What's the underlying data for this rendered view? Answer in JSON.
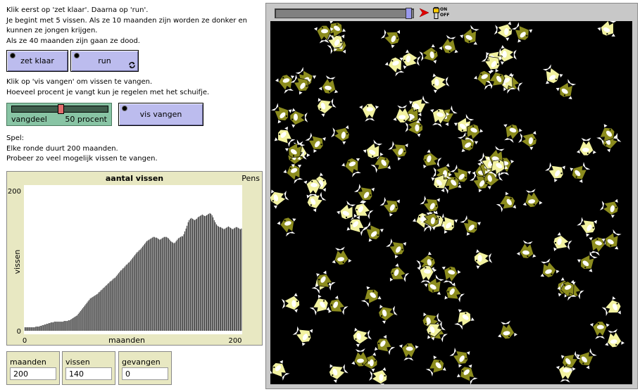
{
  "info": {
    "line1": "Klik eerst op 'zet klaar'. Daarna op 'run'.",
    "line2": "Je begint met 5 vissen. Als ze 10 maanden zijn worden ze donker en",
    "line3": "kunnen ze jongen krijgen.",
    "line4": "Als ze 40 maanden zijn gaan ze dood."
  },
  "buttons": {
    "setup": "zet klaar",
    "run": "run",
    "catch": "vis vangen"
  },
  "catch_info": {
    "line1": "Klik op 'vis vangen' om vissen te vangen.",
    "line2": "Hoeveel procent je vangt kun je regelen met het schuifje."
  },
  "slider": {
    "label": "vangdeel",
    "value_text": "50 procent",
    "value": 50,
    "min": 0,
    "max": 100
  },
  "game_info": {
    "line1": "Spel:",
    "line2": "Elke ronde duurt 200 maanden.",
    "line3": "Probeer zo veel mogelijk vissen te vangen."
  },
  "plot": {
    "title": "aantal vissen",
    "pens_label": "Pens"
  },
  "chart_data": {
    "type": "bar",
    "title": "aantal vissen",
    "xlabel": "maanden",
    "ylabel": "vissen",
    "xlim": [
      0,
      200
    ],
    "ylim": [
      0,
      200
    ],
    "x_ticks": [
      "0",
      "200"
    ],
    "y_ticks": [
      "0",
      "200"
    ],
    "values": [
      5,
      5,
      5,
      5,
      5,
      5,
      5,
      5,
      5,
      5,
      6,
      6,
      6,
      6,
      7,
      7,
      8,
      8,
      9,
      9,
      10,
      10,
      11,
      11,
      12,
      12,
      12,
      13,
      13,
      13,
      13,
      13,
      13,
      13,
      13,
      13,
      14,
      14,
      14,
      14,
      15,
      15,
      16,
      17,
      18,
      19,
      20,
      21,
      22,
      24,
      26,
      28,
      30,
      32,
      34,
      36,
      38,
      40,
      42,
      44,
      46,
      47,
      48,
      49,
      50,
      51,
      52,
      53,
      55,
      56,
      58,
      59,
      61,
      62,
      64,
      65,
      67,
      68,
      70,
      71,
      72,
      74,
      75,
      76,
      78,
      80,
      82,
      84,
      86,
      87,
      89,
      90,
      92,
      94,
      95,
      97,
      98,
      100,
      102,
      104,
      106,
      108,
      110,
      112,
      113,
      115,
      116,
      118,
      120,
      122,
      124,
      126,
      128,
      129,
      130,
      131,
      132,
      133,
      134,
      134,
      133,
      133,
      132,
      131,
      130,
      131,
      132,
      133,
      134,
      134,
      134,
      133,
      132,
      130,
      128,
      127,
      126,
      125,
      126,
      128,
      130,
      132,
      133,
      134,
      135,
      135,
      138,
      142,
      146,
      150,
      155,
      158,
      160,
      161,
      160,
      159,
      158,
      159,
      160,
      162,
      163,
      164,
      165,
      166,
      165,
      164,
      164,
      165,
      166,
      167,
      168,
      167,
      165,
      162,
      158,
      155,
      152,
      150,
      149,
      148,
      148,
      147,
      146,
      145,
      146,
      147,
      148,
      149,
      148,
      147,
      146,
      145,
      146,
      147,
      148,
      148,
      147,
      146,
      145,
      146
    ]
  },
  "monitors": [
    {
      "label": "maanden",
      "value": "200"
    },
    {
      "label": "vissen",
      "value": "140"
    },
    {
      "label": "gevangen",
      "value": "0"
    }
  ],
  "view": {
    "onoff_on": "ON",
    "onoff_off": "OFF",
    "speed_value": 1.0
  },
  "colors": {
    "adult_fish": "#8c8c1e",
    "young_fish": "#f2f2a0",
    "world_bg": "#000000",
    "button_bg": "#bcbcee",
    "plot_bg": "#e8e8c2",
    "slider_bg": "#88c4a4"
  }
}
